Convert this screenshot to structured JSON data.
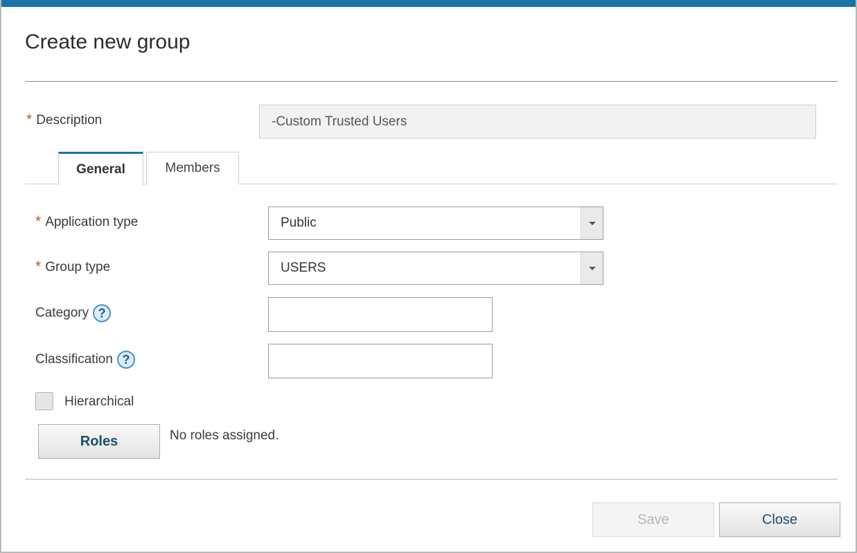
{
  "dialog": {
    "title": "Create new group",
    "accent_color": "#1a74a7",
    "required_color": "#c0531b"
  },
  "description": {
    "required_marker": "*",
    "label": "Description",
    "value": "-Custom Trusted Users"
  },
  "tabs": [
    {
      "label": "General",
      "active": true
    },
    {
      "label": "Members",
      "active": false
    }
  ],
  "general": {
    "application_type": {
      "required_marker": "*",
      "label": "Application type",
      "value": "Public"
    },
    "group_type": {
      "required_marker": "*",
      "label": "Group type",
      "value": "USERS"
    },
    "category": {
      "label": "Category",
      "help_glyph": "?",
      "value": ""
    },
    "classification": {
      "label": "Classification",
      "help_glyph": "?",
      "value": ""
    },
    "hierarchical": {
      "label": "Hierarchical",
      "checked": false
    },
    "roles": {
      "button_label": "Roles",
      "status": "No roles assigned."
    }
  },
  "footer": {
    "save_label": "Save",
    "save_enabled": false,
    "close_label": "Close"
  }
}
